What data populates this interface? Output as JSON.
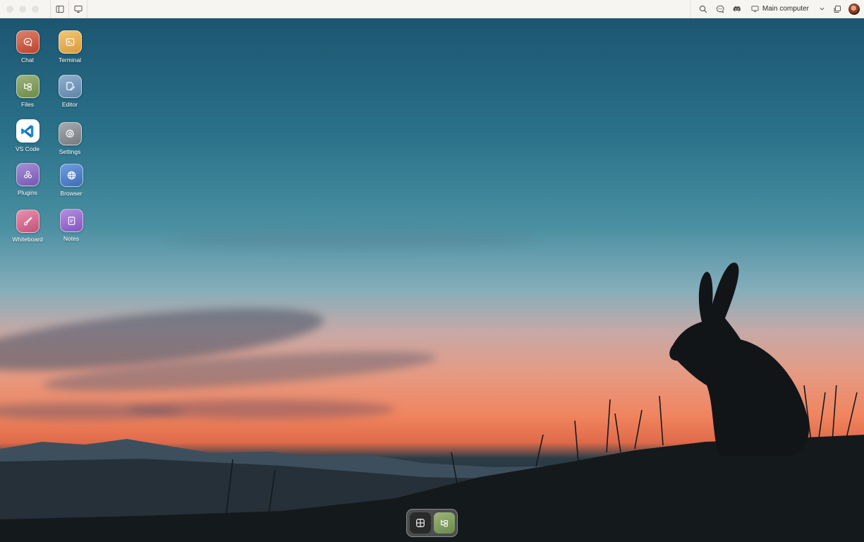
{
  "topbar": {
    "traffic_lights": [
      "close",
      "minimize",
      "maximize"
    ],
    "left_buttons": [
      {
        "name": "sidebar-toggle-icon"
      },
      {
        "name": "display-icon"
      }
    ],
    "right_icons": [
      "search-icon",
      "chat-bubble-icon",
      "discord-icon"
    ],
    "machine_label": "Main computer",
    "machine_icon": "monitor-icon",
    "extra_icon": "copy-window-icon",
    "avatar": "user-avatar"
  },
  "desktop_icons": [
    {
      "label": "Chat",
      "icon": "chat-icon",
      "color": "#c8553f"
    },
    {
      "label": "Terminal",
      "icon": "terminal-icon",
      "color": "#e0a84a"
    },
    {
      "label": "Files",
      "icon": "folder-tree-icon",
      "color": "#7d9a5e"
    },
    {
      "label": "Editor",
      "icon": "edit-file-icon",
      "color": "#6a8fb3"
    },
    {
      "label": "VS Code",
      "icon": "vscode-icon",
      "color": "#ffffff"
    },
    {
      "label": "Settings",
      "icon": "gear-icon",
      "color": "#8a8e93"
    },
    {
      "label": "Plugins",
      "icon": "plugins-icon",
      "color": "#8b6fc2"
    },
    {
      "label": "Browser",
      "icon": "globe-icon",
      "color": "#4f7fc4"
    },
    {
      "label": "Whiteboard",
      "icon": "brush-icon",
      "color": "#d46a8e"
    },
    {
      "label": "Notes",
      "icon": "notes-icon",
      "color": "#9a6ac8"
    }
  ],
  "dock": {
    "items": [
      {
        "name": "app-grid-icon",
        "active": false
      },
      {
        "name": "files-icon",
        "active": true
      }
    ]
  }
}
